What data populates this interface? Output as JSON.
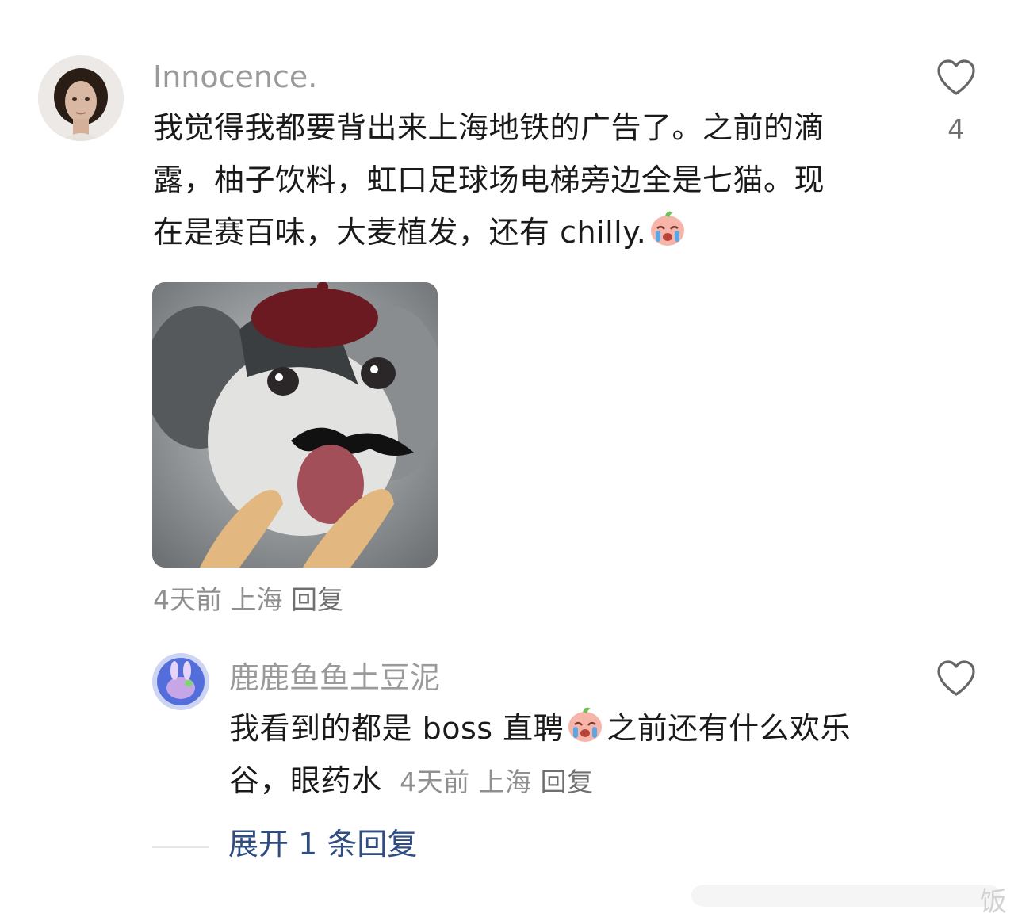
{
  "comment": {
    "username": "Innocence.",
    "text_line1": "我觉得我都要背出来上海地铁的广告了。之前的滴",
    "text_line2": "露，柚子饮料，虹口足球场电梯旁边全是七猫。现",
    "text_line3": "在是赛百味，大麦植发，还有 chilly.",
    "like_count": "4",
    "time": "4天前",
    "location": "上海",
    "reply_label": "回复",
    "image": "crying-cat-meme-with-beret-mustache-hands"
  },
  "reply": {
    "username": "鹿鹿鱼鱼土豆泥",
    "text_line1_a": "我看到的都是 boss 直聘",
    "text_line1_b": "之前还有什么欢乐",
    "text_line2": "谷，眼药水",
    "time": "4天前",
    "location": "上海",
    "reply_label": "回复"
  },
  "expand_label": "展开 1 条回复",
  "watermark": "饭",
  "colors": {
    "username": "#9a9a9a",
    "text": "#1a1a1a",
    "meta": "#8f8f8f",
    "link": "#2f4d80"
  },
  "icons": [
    "heart-outline-icon",
    "crying-emoji-icon"
  ]
}
